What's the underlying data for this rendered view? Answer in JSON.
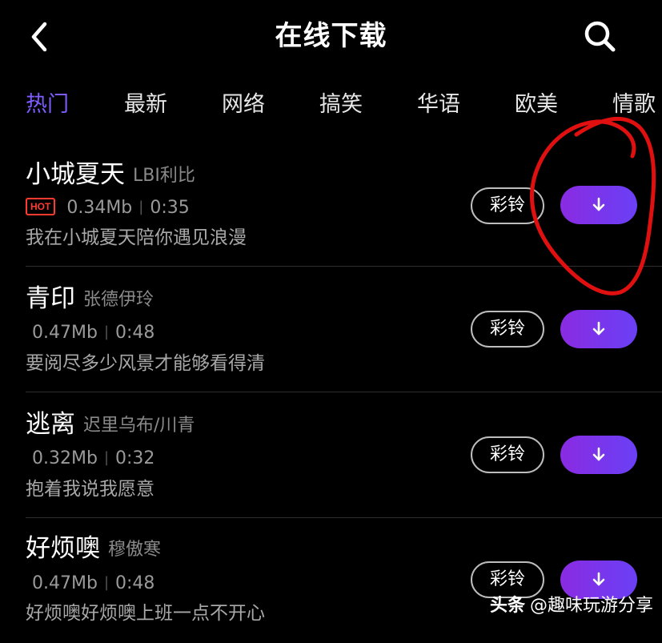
{
  "header": {
    "title": "在线下载",
    "back_icon": "chevron-left-icon",
    "search_icon": "search-icon"
  },
  "tabs": [
    {
      "label": "热门",
      "active": true
    },
    {
      "label": "最新",
      "active": false
    },
    {
      "label": "网络",
      "active": false
    },
    {
      "label": "搞笑",
      "active": false
    },
    {
      "label": "华语",
      "active": false
    },
    {
      "label": "欧美",
      "active": false
    },
    {
      "label": "情歌",
      "active": false
    }
  ],
  "songs": [
    {
      "name": "小城夏天",
      "artist": "LBI利比",
      "badge": "HOT",
      "size": "0.34Mb",
      "duration": "0:35",
      "lyric": "我在小城夏天陪你遇见浪漫",
      "ringtone_label": "彩铃"
    },
    {
      "name": "青印",
      "artist": "张德伊玲",
      "badge": "",
      "size": "0.47Mb",
      "duration": "0:48",
      "lyric": "要阅尽多少风景才能够看得清",
      "ringtone_label": "彩铃"
    },
    {
      "name": "逃离",
      "artist": "迟里乌布/川青",
      "badge": "",
      "size": "0.32Mb",
      "duration": "0:32",
      "lyric": "抱着我说我愿意",
      "ringtone_label": "彩铃"
    },
    {
      "name": "好烦噢",
      "artist": "穆傲寒",
      "badge": "",
      "size": "0.47Mb",
      "duration": "0:48",
      "lyric": "好烦噢好烦噢上班一点不开心",
      "ringtone_label": "彩铃"
    }
  ],
  "watermark": {
    "brand": "头条",
    "handle": "@趣味玩游分享"
  },
  "colors": {
    "background": "#000000",
    "accent": "#7f5cff",
    "download_gradient_start": "#8a2be2",
    "download_gradient_end": "#6a40f5",
    "hot": "#ff3b30",
    "annotation": "#e01010"
  }
}
